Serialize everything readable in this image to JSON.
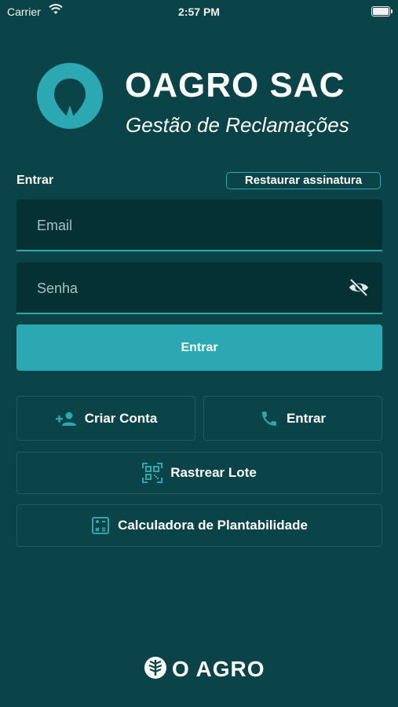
{
  "status_bar": {
    "carrier": "Carrier",
    "time": "2:57 PM"
  },
  "header": {
    "title": "OAGRO SAC",
    "subtitle": "Gestão de Reclamações"
  },
  "login": {
    "section_label": "Entrar",
    "restore_label": "Restaurar assinatura",
    "email_placeholder": "Email",
    "password_placeholder": "Senha",
    "submit_label": "Entrar"
  },
  "actions": {
    "create_account": "Criar Conta",
    "phone_login": "Entrar",
    "track_lot": "Rastrear Lote",
    "calculator": "Calculadora de Plantabilidade"
  },
  "footer": {
    "brand": "O AGRO"
  },
  "colors": {
    "background": "#0b4448",
    "accent": "#2ba8b1",
    "field": "#053134",
    "icon": "#2aa8b0"
  },
  "icons": [
    "wifi-icon",
    "battery-icon",
    "app-logo-icon",
    "eye-off-icon",
    "add-person-icon",
    "phone-icon",
    "qr-code-icon",
    "calculator-icon",
    "brand-logo-icon"
  ]
}
